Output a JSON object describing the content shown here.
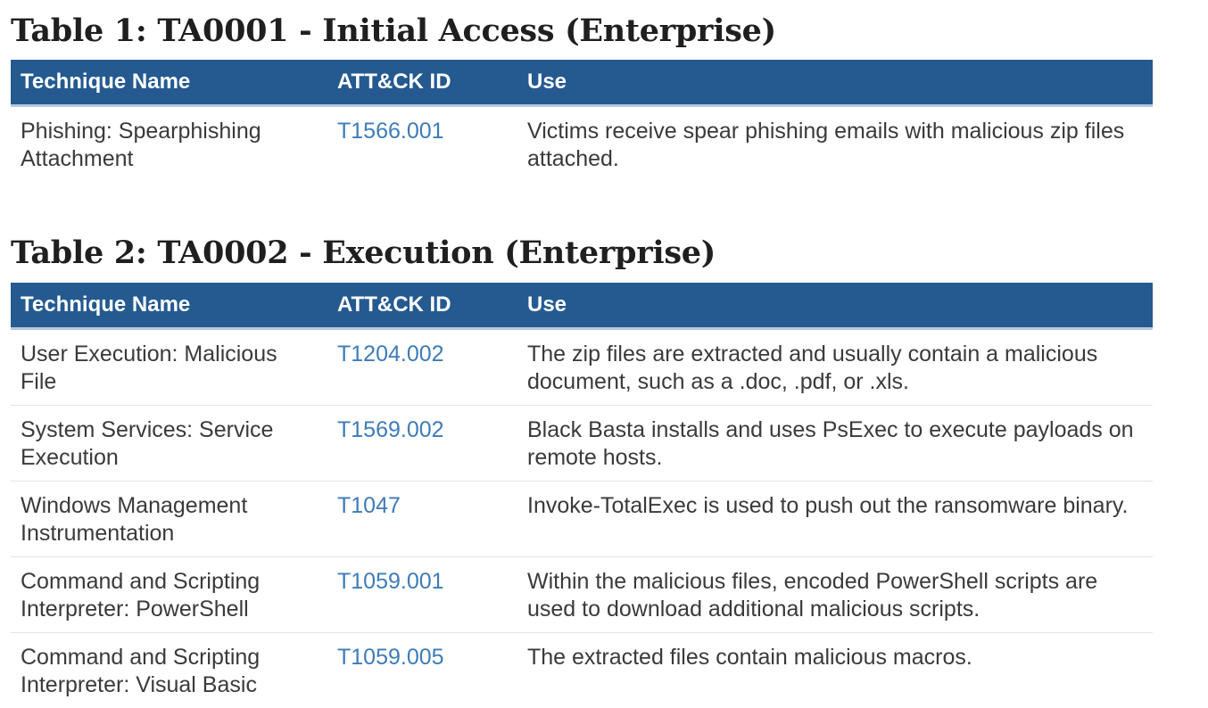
{
  "tables": [
    {
      "title": "Table 1: TA0001 - Initial Access (Enterprise)",
      "headers": [
        "Technique Name",
        "ATT&CK ID",
        "Use"
      ],
      "rows": [
        {
          "technique": "Phishing: Spearphishing Attachment",
          "id": "T1566.001",
          "use": "Victims receive spear phishing emails with malicious zip files attached."
        }
      ]
    },
    {
      "title": "Table 2: TA0002 - Execution (Enterprise)",
      "headers": [
        "Technique Name",
        "ATT&CK ID",
        "Use"
      ],
      "rows": [
        {
          "technique": "User Execution: Malicious File",
          "id": "T1204.002",
          "use": "The zip files are extracted and usually contain a malicious document, such as a .doc, .pdf, or .xls."
        },
        {
          "technique": "System Services: Service Execution",
          "id": "T1569.002",
          "use": "Black Basta installs and uses PsExec to execute payloads on remote hosts."
        },
        {
          "technique": "Windows Management Instrumentation",
          "id": "T1047",
          "use": "Invoke-TotalExec is used to push out the ransomware binary."
        },
        {
          "technique": "Command and Scripting Interpreter: PowerShell",
          "id": "T1059.001",
          "use": "Within the malicious files, encoded PowerShell scripts are used to download additional malicious scripts."
        },
        {
          "technique": "Command and Scripting Interpreter: Visual Basic",
          "id": "T1059.005",
          "use": "The extracted files contain malicious macros."
        }
      ]
    }
  ],
  "colors": {
    "header_bg": "#245a90",
    "header_text": "#ffffff",
    "link": "#3d7cb8",
    "body_text": "#3a3a3a",
    "title_text": "#1f1f1f"
  }
}
